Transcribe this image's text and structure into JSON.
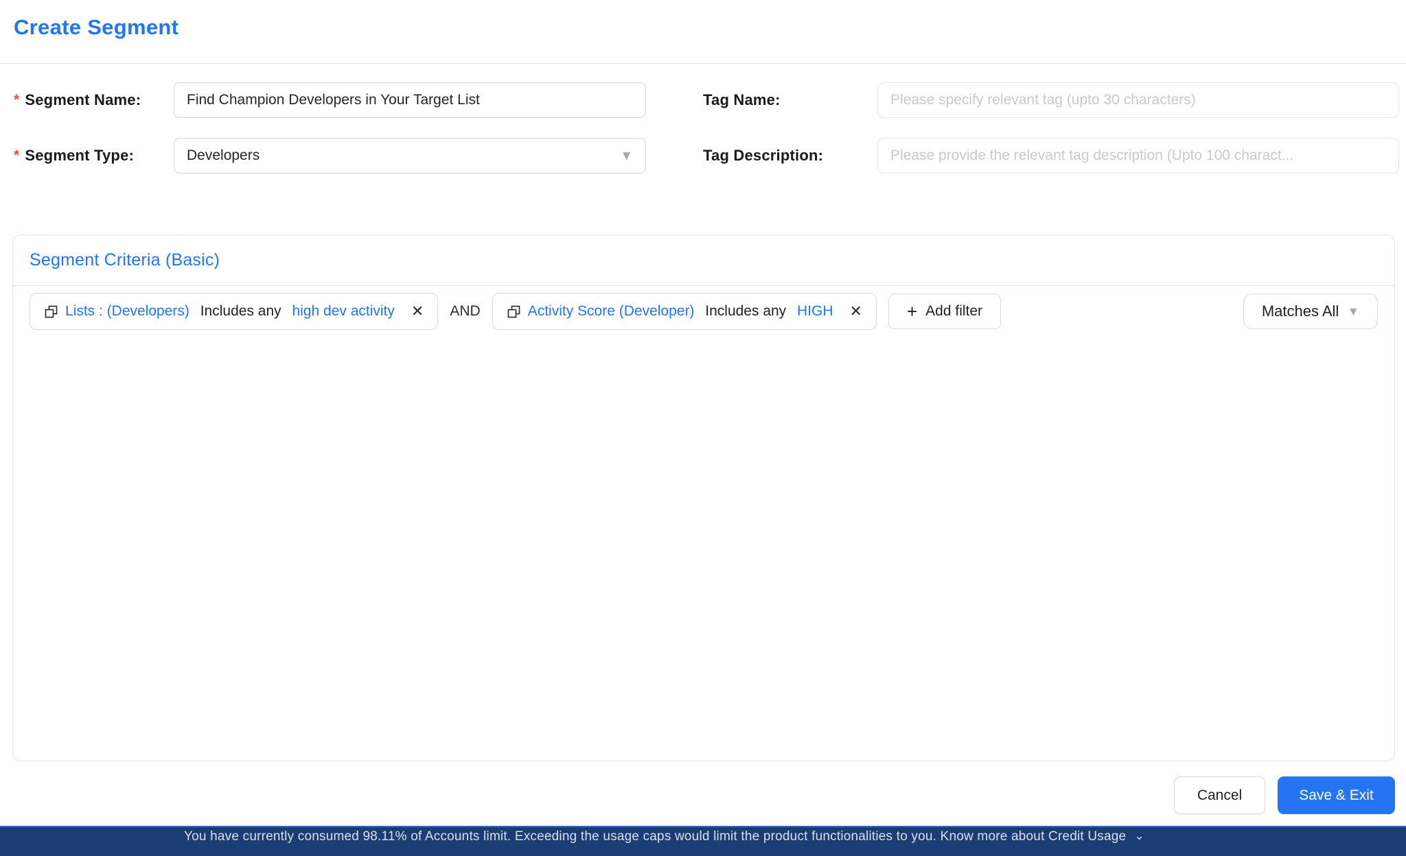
{
  "colors": {
    "accent_blue": "#2276f2",
    "save_button_blue": "#2574f4",
    "required_red": "#e8504a",
    "banner_navy": "#1c3c74"
  },
  "header": {
    "title": "Create Segment"
  },
  "form": {
    "required_marker": "*",
    "segment_name": {
      "label": "Segment Name:",
      "value": "Find Champion Developers in Your Target List"
    },
    "segment_type": {
      "label": "Segment Type:",
      "value": "Developers"
    },
    "tag_name": {
      "label": "Tag Name:",
      "placeholder": "Please specify relevant tag (upto 30 characters)"
    },
    "tag_description": {
      "label": "Tag Description:",
      "placeholder": "Please provide the relevant tag description (Upto 100 charact..."
    }
  },
  "criteria": {
    "title": "Segment Criteria (Basic)",
    "connector": "AND",
    "filters": [
      {
        "field": "Lists : (Developers)",
        "operator": " Includes any ",
        "value": "high dev activity"
      },
      {
        "field": "Activity Score (Developer)",
        "operator": " Includes any ",
        "value": "HIGH"
      }
    ],
    "add_filter_label": "Add filter",
    "match_mode": "Matches All"
  },
  "footer": {
    "cancel_label": "Cancel",
    "save_label": "Save & Exit"
  },
  "usage_banner": {
    "text": "You have currently consumed 98.11% of Accounts limit. Exceeding the usage caps would limit the product functionalities to you. Know more about Credit Usage"
  },
  "icons": {
    "close": "✕",
    "plus": "+",
    "caret_down": "▼",
    "chevron_down": "⌄"
  }
}
